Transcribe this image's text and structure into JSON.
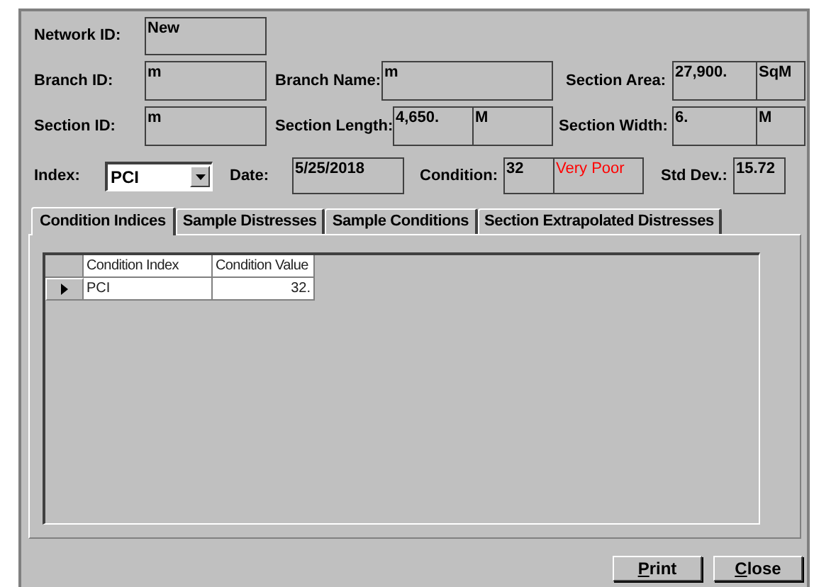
{
  "rows": [
    [
      {
        "kind": "field",
        "label": "Network ID:",
        "values": [
          {
            "kind": "value",
            "text": "New"
          }
        ]
      }
    ],
    [
      {
        "kind": "field",
        "label": "Branch ID:",
        "values": [
          {
            "kind": "value",
            "text": "m"
          }
        ]
      },
      {
        "kind": "field",
        "label": "Branch Name:",
        "values": [
          {
            "kind": "value",
            "text": "m"
          }
        ]
      },
      {
        "kind": "field",
        "label": "Section Area:",
        "values": [
          {
            "kind": "value",
            "text": "27,900."
          },
          {
            "kind": "unit",
            "text": "SqM"
          }
        ]
      }
    ],
    [
      {
        "kind": "field",
        "label": "Section ID:",
        "values": [
          {
            "kind": "value",
            "text": "m"
          }
        ]
      },
      {
        "kind": "field",
        "label": "Section Length:",
        "values": [
          {
            "kind": "value",
            "text": "4,650."
          },
          {
            "kind": "unit",
            "text": "M"
          }
        ]
      },
      {
        "kind": "field",
        "label": "Section Width:",
        "values": [
          {
            "kind": "value",
            "text": "6."
          },
          {
            "kind": "unit",
            "text": "M"
          }
        ]
      }
    ],
    [
      {
        "kind": "dropdown",
        "label": "Index:",
        "value": "PCI"
      },
      {
        "kind": "field",
        "label": "Date:",
        "values": [
          {
            "kind": "value",
            "text": "5/25/2018"
          }
        ]
      },
      {
        "kind": "field",
        "label": "Condition:",
        "values": [
          {
            "kind": "value",
            "text": "32"
          },
          {
            "kind": "rating",
            "text": "Very Poor"
          }
        ]
      },
      {
        "kind": "field",
        "label": "Std Dev.:",
        "values": [
          {
            "kind": "value",
            "text": "15.72"
          }
        ]
      }
    ]
  ],
  "tabs": [
    {
      "label": "Condition Indices",
      "selected": true
    },
    {
      "label": "Sample Distresses",
      "selected": false
    },
    {
      "label": "Sample Conditions",
      "selected": false
    },
    {
      "label": "Section Extrapolated Distresses",
      "selected": false
    }
  ],
  "table": {
    "columns": [
      "Condition Index",
      "Condition Value"
    ],
    "rows": [
      {
        "selected": true,
        "cells": [
          "PCI",
          "32."
        ]
      }
    ]
  },
  "buttons": [
    "Print",
    "Close"
  ]
}
